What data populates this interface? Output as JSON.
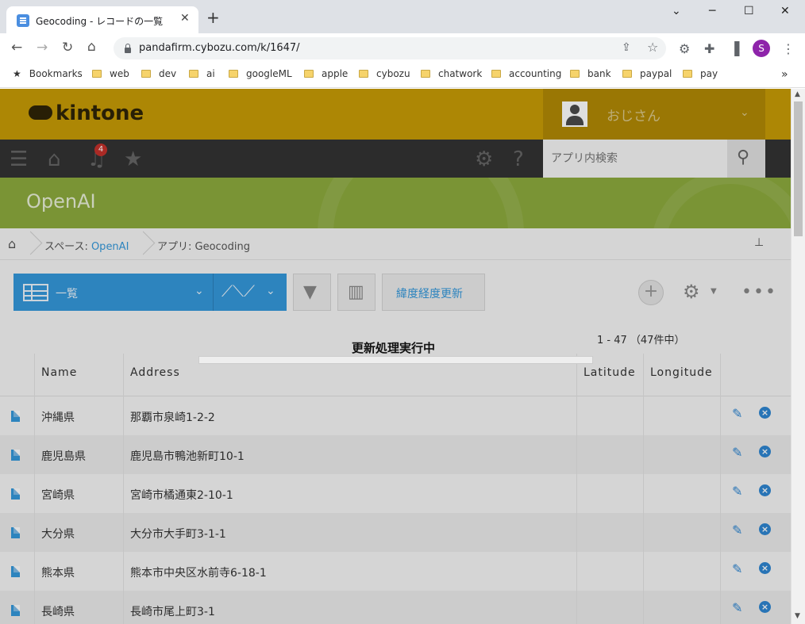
{
  "browser": {
    "tab_title": "Geocoding - レコードの一覧",
    "tab_close": "✕",
    "new_tab": "+",
    "url": "pandafirm.cybozu.com/k/1647/",
    "avatar_letter": "S",
    "bookmarks": [
      {
        "label": "Bookmarks",
        "icon": "star-icon"
      },
      {
        "label": "web"
      },
      {
        "label": "dev"
      },
      {
        "label": "ai"
      },
      {
        "label": "googleML"
      },
      {
        "label": "apple"
      },
      {
        "label": "cybozu"
      },
      {
        "label": "chatwork"
      },
      {
        "label": "accounting"
      },
      {
        "label": "bank"
      },
      {
        "label": "paypal"
      },
      {
        "label": "pay"
      }
    ]
  },
  "kintone": {
    "logo": "kintone",
    "user_name": "おじさん",
    "notification_count": "4",
    "search_placeholder": "アプリ内検索",
    "app_title": "OpenAI",
    "breadcrumb": {
      "space_prefix": "スペース: ",
      "space_name": "OpenAI",
      "app_label": "アプリ: Geocoding"
    },
    "view_name": "一覧",
    "custom_button": "緯度経度更新",
    "pager": "1 - 47 （47件中）",
    "progress_text": "更新処理実行中",
    "columns": [
      "Name",
      "Address",
      "Latitude",
      "Longitude"
    ],
    "rows": [
      {
        "name": "沖縄県",
        "address": "那覇市泉崎1-2-2"
      },
      {
        "name": "鹿児島県",
        "address": "鹿児島市鴨池新町10-1"
      },
      {
        "name": "宮崎県",
        "address": "宮崎市橘通東2-10-1"
      },
      {
        "name": "大分県",
        "address": "大分市大手町3-1-1"
      },
      {
        "name": "熊本県",
        "address": "熊本市中央区水前寺6-18-1"
      },
      {
        "name": "長崎県",
        "address": "長崎市尾上町3-1"
      }
    ]
  },
  "colors": {
    "header": "#c79b06",
    "banner": "#8daa3d",
    "accent": "#3498db"
  }
}
